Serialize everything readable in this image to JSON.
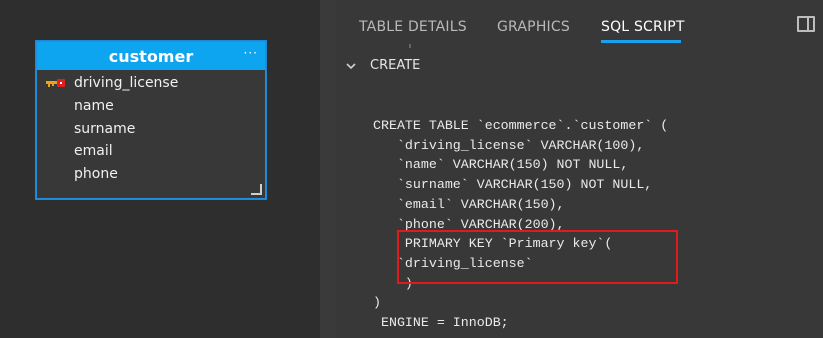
{
  "entity": {
    "name": "customer",
    "menu_glyph": "···",
    "fields": [
      {
        "label": "driving_license",
        "is_key": true
      },
      {
        "label": "name",
        "is_key": false
      },
      {
        "label": "surname",
        "is_key": false
      },
      {
        "label": "email",
        "is_key": false
      },
      {
        "label": "phone",
        "is_key": false
      }
    ]
  },
  "tabs": [
    {
      "label": "TABLE DETAILS",
      "active": false
    },
    {
      "label": "GRAPHICS",
      "active": false
    },
    {
      "label": "SQL SCRIPT",
      "active": true
    }
  ],
  "section": {
    "label": "CREATE"
  },
  "sql_lines": [
    "CREATE TABLE `ecommerce`.`customer` (",
    "   `driving_license` VARCHAR(100),",
    "   `name` VARCHAR(150) NOT NULL,",
    "   `surname` VARCHAR(150) NOT NULL,",
    "   `email` VARCHAR(150),",
    "   `phone` VARCHAR(200),",
    "    PRIMARY KEY `Primary key`(",
    "   `driving_license`",
    "    )",
    ")",
    " ENGINE = InnoDB;"
  ],
  "colors": {
    "accent": "#0ea5f0",
    "highlight_border": "#e01b1b"
  }
}
